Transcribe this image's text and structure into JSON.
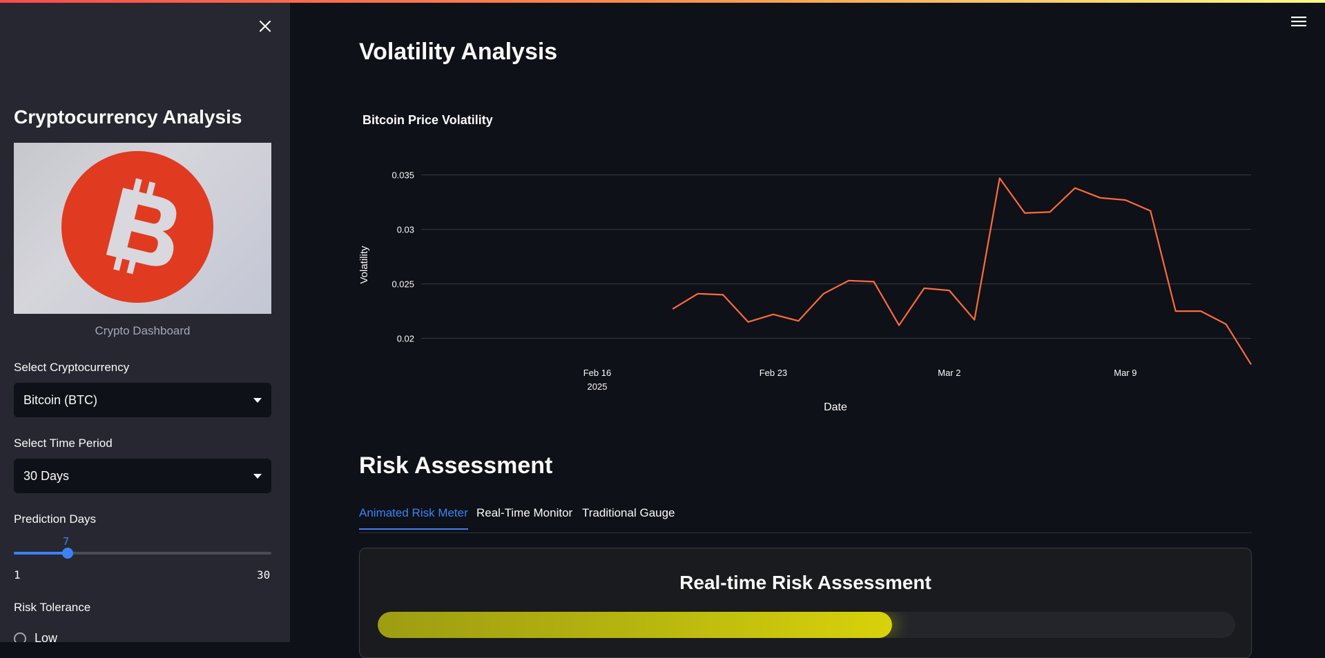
{
  "sidebar": {
    "title": "Cryptocurrency Analysis",
    "image_caption": "Crypto Dashboard",
    "crypto_label": "Select Cryptocurrency",
    "crypto_value": "Bitcoin (BTC)",
    "period_label": "Select Time Period",
    "period_value": "30 Days",
    "prediction_label": "Prediction Days",
    "prediction_value": "7",
    "prediction_min": "1",
    "prediction_max": "30",
    "risk_label": "Risk Tolerance",
    "risk_options": [
      "Low"
    ]
  },
  "main": {
    "heading": "Volatility Analysis",
    "risk_heading": "Risk Assessment",
    "tabs": [
      {
        "label": "Animated Risk Meter",
        "active": true
      },
      {
        "label": "Real-Time Monitor",
        "active": false
      },
      {
        "label": "Traditional Gauge",
        "active": false
      }
    ],
    "risk_card_title": "Real-time Risk Assessment",
    "risk_level_fraction": 0.6
  },
  "colors": {
    "accent": "#3b82f6",
    "line": "#ff6b3d",
    "bitcoin": "#e03a21"
  },
  "chart_data": {
    "type": "line",
    "title": "Bitcoin Price Volatility",
    "xlabel": "Date",
    "ylabel": "Volatility",
    "x": [
      "2025-02-18",
      "2025-02-19",
      "2025-02-20",
      "2025-02-21",
      "2025-02-22",
      "2025-02-23",
      "2025-02-24",
      "2025-02-25",
      "2025-02-26",
      "2025-02-27",
      "2025-02-28",
      "2025-03-01",
      "2025-03-02",
      "2025-03-03",
      "2025-03-04",
      "2025-03-05",
      "2025-03-06",
      "2025-03-07",
      "2025-03-08",
      "2025-03-09",
      "2025-03-10",
      "2025-03-11",
      "2025-03-12",
      "2025-03-13",
      "2025-03-14"
    ],
    "series": [
      {
        "values": [
          0.0227,
          0.0241,
          0.024,
          0.0215,
          0.0222,
          0.0216,
          0.0241,
          0.0253,
          0.0252,
          0.0212,
          0.0246,
          0.0244,
          0.0217,
          0.0347,
          0.0315,
          0.0316,
          0.0338,
          0.0329,
          0.0327,
          0.0317,
          0.0225,
          0.0225,
          0.0213,
          0.0176
        ]
      }
    ],
    "x_ticks": [
      {
        "date": "2025-02-16",
        "label": "Feb 16",
        "sublabel": "2025"
      },
      {
        "date": "2025-02-23",
        "label": "Feb 23"
      },
      {
        "date": "2025-03-02",
        "label": "Mar 2"
      },
      {
        "date": "2025-03-09",
        "label": "Mar 9"
      }
    ],
    "y_ticks": [
      0.02,
      0.025,
      0.03,
      0.035
    ],
    "y_tick_labels": [
      "0.02",
      "0.025",
      "0.03",
      "0.035"
    ],
    "xlim": [
      "2025-02-09",
      "2025-03-14"
    ],
    "ylim": [
      0.0175,
      0.0365
    ],
    "grid": true
  }
}
